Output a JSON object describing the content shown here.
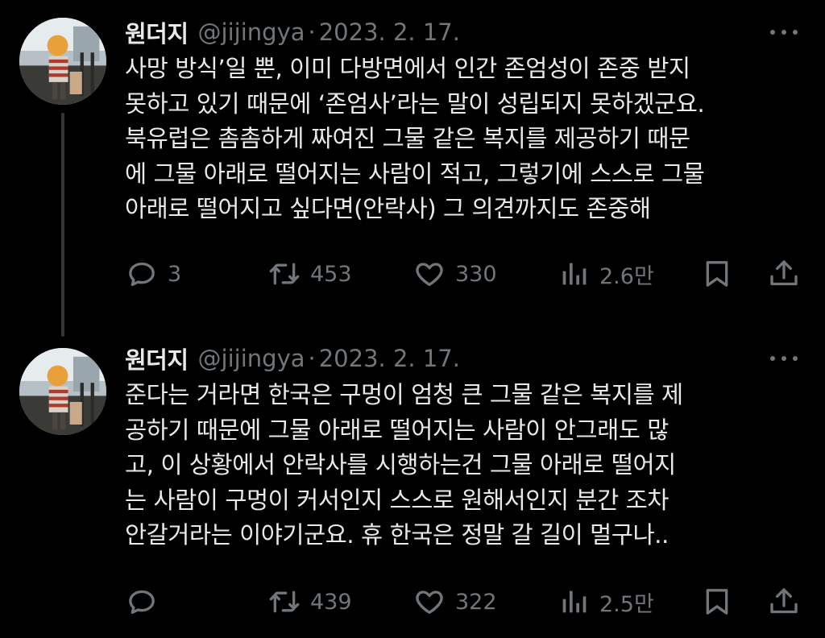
{
  "colors": {
    "background": "#000000",
    "primary_text": "#e7e9ea",
    "secondary_text": "#71767b",
    "thread_line": "#333639"
  },
  "tweets": [
    {
      "author_name": "원더지",
      "handle": "@jijingya",
      "separator": "·",
      "date": "2023. 2. 17.",
      "more_icon": "more-horizontal-icon",
      "lines": [
        "사망 방식’일 뿐, 이미 다방면에서 인간 존엄성이 존중 받지",
        "못하고 있기 때문에 ‘존엄사’라는 말이 성립되지 못하겠군요.",
        "북유럽은 촘촘하게 짜여진 그물 같은 복지를 제공하기 때문",
        "에 그물 아래로 떨어지는 사람이 적고, 그렇기에 스스로 그물",
        "아래로 떨어지고 싶다면(안락사) 그 의견까지도 존중해"
      ],
      "stats": {
        "replies": "3",
        "retweets": "453",
        "likes": "330",
        "views": "2.6만"
      }
    },
    {
      "author_name": "원더지",
      "handle": "@jijingya",
      "separator": "·",
      "date": "2023. 2. 17.",
      "more_icon": "more-horizontal-icon",
      "lines": [
        "준다는 거라면 한국은 구멍이 엄청 큰 그물 같은 복지를 제",
        "공하기 때문에 그물 아래로 떨어지는 사람이 안그래도 많",
        "고, 이 상황에서 안락사를 시행하는건 그물 아래로 떨어지",
        "는 사람이 구멍이 커서인지 스스로 원해서인지 분간 조차",
        "안갈거라는 이야기군요. 휴 한국은 정말 갈 길이 멀구나.."
      ],
      "stats": {
        "replies": "",
        "retweets": "439",
        "likes": "322",
        "views": "2.5만"
      }
    }
  ]
}
